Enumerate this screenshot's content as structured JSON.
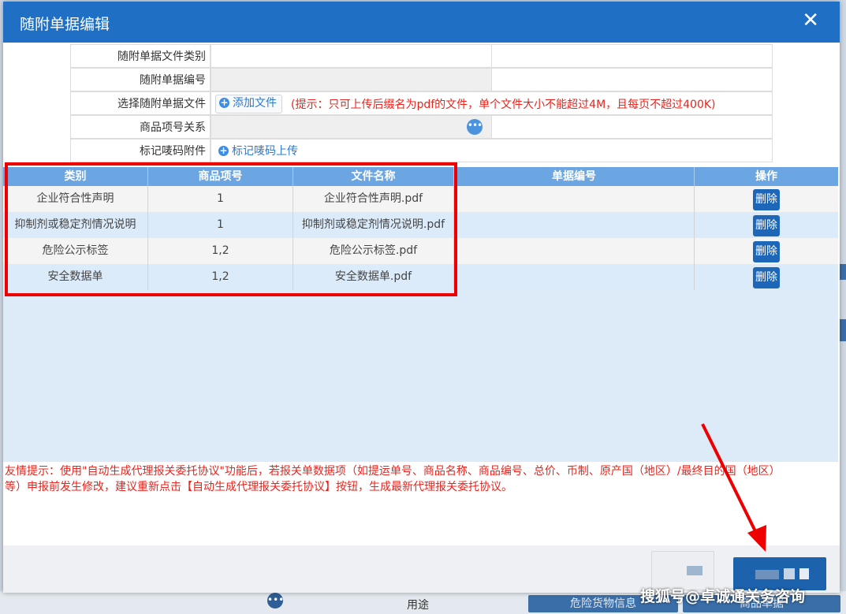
{
  "dialog": {
    "title": "随附单据编辑",
    "close_glyph": "✕"
  },
  "form": {
    "doc_type_label": "随附单据文件类别",
    "doc_no_label": "随附单据编号",
    "select_file_label": "选择随附单据文件",
    "add_file_button": "添加文件",
    "upload_hint": "(提示：只可上传后缀名为pdf的文件，单个文件大小不能超过4M，且每页不超过400K)",
    "item_relation_label": "商品项号关系",
    "barcode_label": "标记唛码附件",
    "barcode_upload_link": "标记唛码上传"
  },
  "table": {
    "headers": [
      "类别",
      "商品项号",
      "文件名称",
      "单据编号",
      "操作"
    ],
    "rows": [
      {
        "category": "企业符合性声明",
        "item_no": "1",
        "file_name": "企业符合性声明.pdf",
        "doc_no": "",
        "action": "删除"
      },
      {
        "category": "抑制剂或稳定剂情况说明",
        "item_no": "1",
        "file_name": "抑制剂或稳定剂情况说明.pdf",
        "doc_no": "",
        "action": "删除"
      },
      {
        "category": "危险公示标签",
        "item_no": "1,2",
        "file_name": "危险公示标签.pdf",
        "doc_no": "",
        "action": "删除"
      },
      {
        "category": "安全数据单",
        "item_no": "1,2",
        "file_name": "安全数据单.pdf",
        "doc_no": "",
        "action": "删除"
      }
    ]
  },
  "tips": {
    "line1": "友情提示：使用\"自动生成代理报关委托协议\"功能后，若报关单数据项（如提运单号、商品名称、商品编号、总价、币制、原产国（地区）/最终目的国（地区）",
    "line2": "等）申报前发生修改，建议重新点击【自动生成代理报关委托协议】按钮，生成最新代理报关委托协议。"
  },
  "background": {
    "usage_label": "用途",
    "dangerous_goods_button": "危险货物信息",
    "goods_docs_button": "商品单据",
    "more_glyph": "•••"
  },
  "watermark": "搜狐号@卓诚通关务咨询",
  "colors": {
    "title_bar": "#1f6fc4",
    "grid_header": "#6ba6e2",
    "highlight_box": "#ee0000",
    "hint_text": "#e8241d",
    "delete_button": "#1e66b8"
  }
}
